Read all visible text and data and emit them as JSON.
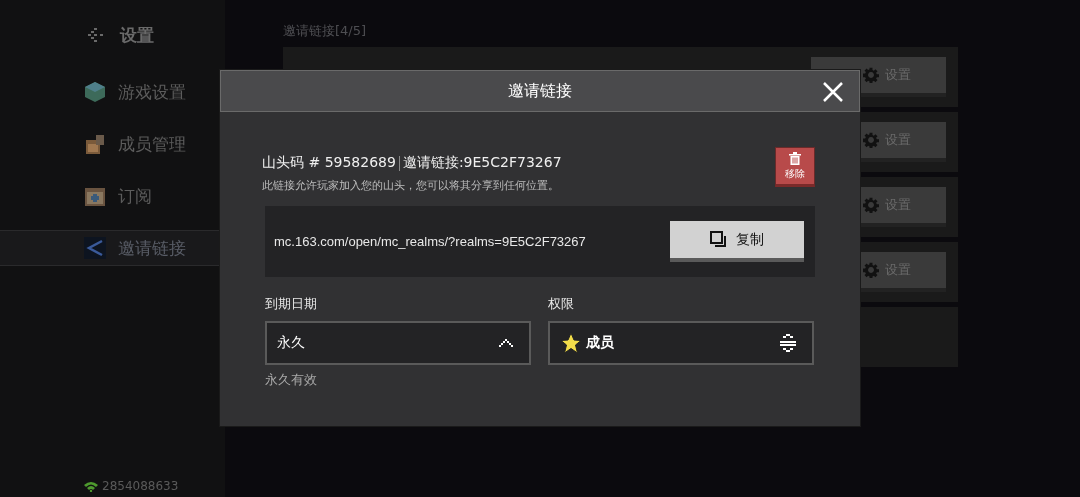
{
  "sidebar": {
    "title": "设置",
    "items": [
      {
        "label": "游戏设置",
        "kind": "cube",
        "selected": false
      },
      {
        "label": "成员管理",
        "kind": "members",
        "selected": false
      },
      {
        "label": "订阅",
        "kind": "calendar",
        "selected": false
      },
      {
        "label": "邀请链接",
        "kind": "share",
        "selected": true
      }
    ],
    "status": "2854088633"
  },
  "invites": {
    "heading": "邀请链接[4/5]",
    "rows": [
      {
        "button": "设置"
      },
      {
        "button": "设置"
      },
      {
        "button": "设置"
      },
      {
        "button": "设置"
      }
    ]
  },
  "dialog": {
    "title": "邀请链接",
    "realm_code": "山头码 # 59582689",
    "invite_code": "邀请链接:9E5C2F73267",
    "description": "此链接允许玩家加入您的山头，您可以将其分享到任何位置。",
    "remove_button": "移除",
    "link": "mc.163.com/open/mc_realms/?realms=9E5C2F73267",
    "copy_button": "复制",
    "expiry": {
      "label": "到期日期",
      "value": "永久",
      "hint": "永久有效"
    },
    "permission": {
      "label": "权限",
      "value": "成员"
    }
  }
}
